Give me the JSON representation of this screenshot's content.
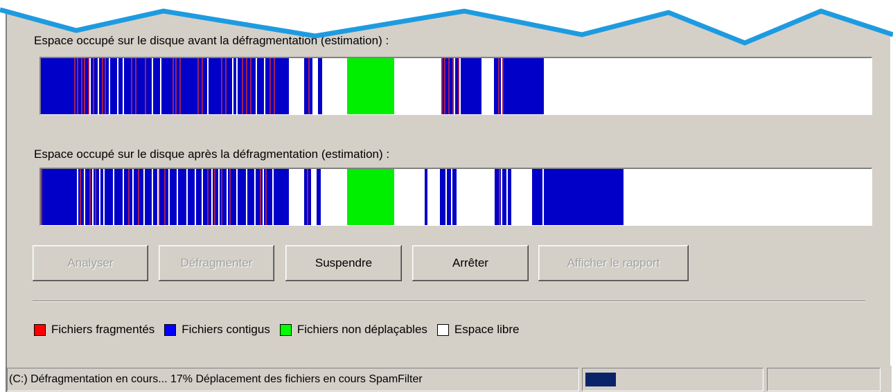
{
  "before": {
    "label": "Espace occupé sur le disque avant la défragmentation (estimation) :"
  },
  "after": {
    "label": "Espace occupé sur le disque après la défragmentation (estimation) :"
  },
  "buttons": [
    {
      "label": "Analyser",
      "enabled": false
    },
    {
      "label": "Défragmenter",
      "enabled": false
    },
    {
      "label": "Suspendre",
      "enabled": true
    },
    {
      "label": "Arrêter",
      "enabled": true
    },
    {
      "label": "Afficher le rapport",
      "enabled": false
    }
  ],
  "legend": [
    {
      "label": "Fichiers fragmentés",
      "color": "#ff0000"
    },
    {
      "label": "Fichiers contigus",
      "color": "#0000ff"
    },
    {
      "label": "Fichiers non déplaçables",
      "color": "#00ff00"
    },
    {
      "label": "Espace libre",
      "color": "#ffffff"
    }
  ],
  "status": {
    "text": "(C:) Défragmentation en cours... 17%  Déplacement des fichiers en cours SpamFilter",
    "progress_percent": 17
  },
  "colors": {
    "fragmented_on_bar": "#a0205a",
    "contiguous": "#0000c8",
    "unmovable": "#00ee00",
    "free": "#ffffff",
    "window": "#d4d0c8",
    "torn_edge": "#1e9be0"
  }
}
